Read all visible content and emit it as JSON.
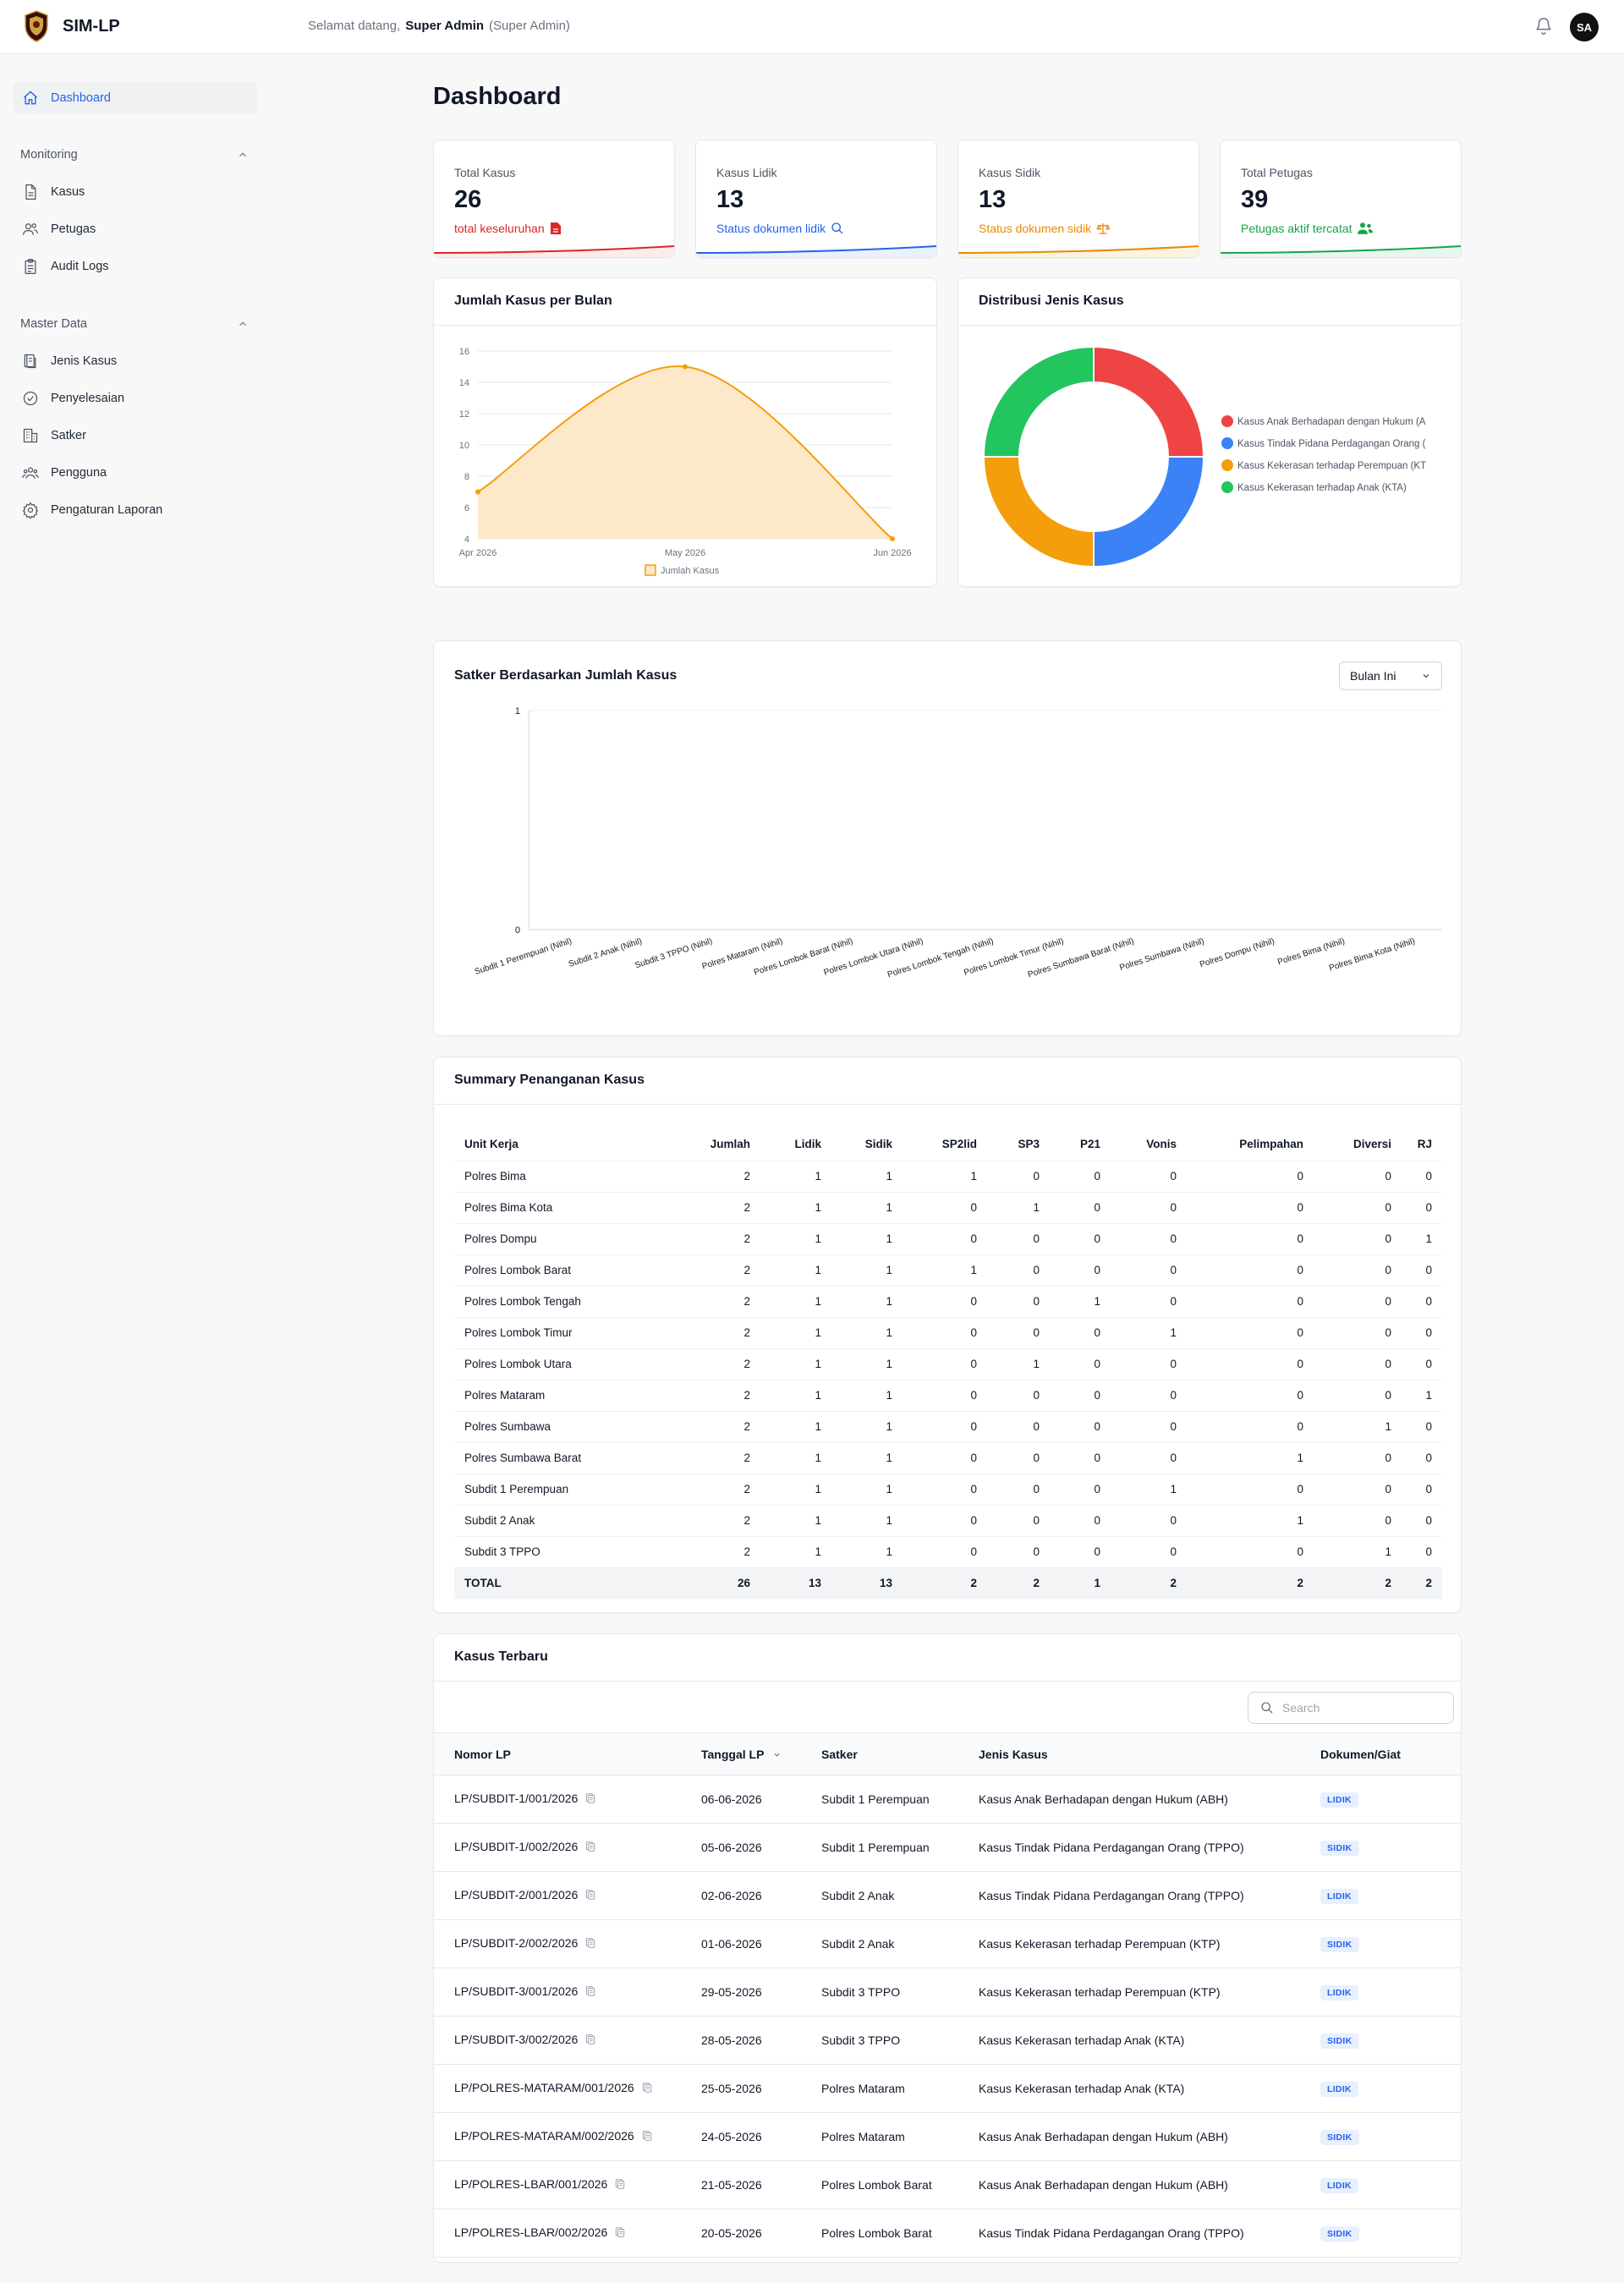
{
  "header": {
    "app_name": "SIM-LP",
    "welcome_prefix": "Selamat datang,",
    "user_name": "Super Admin",
    "user_role": "(Super Admin)",
    "avatar_initials": "SA"
  },
  "sidebar": {
    "dashboard": "Dashboard",
    "group_monitoring": "Monitoring",
    "monitoring_items": [
      "Kasus",
      "Petugas",
      "Audit Logs"
    ],
    "group_master": "Master Data",
    "master_items": [
      "Jenis Kasus",
      "Penyelesaian",
      "Satker",
      "Pengguna",
      "Pengaturan Laporan"
    ]
  },
  "page": {
    "title": "Dashboard"
  },
  "stats": [
    {
      "label": "Total Kasus",
      "value": "26",
      "sub": "total keseluruhan",
      "color": "#dc2626"
    },
    {
      "label": "Kasus Lidik",
      "value": "13",
      "sub": "Status dokumen lidik",
      "color": "#2563eb"
    },
    {
      "label": "Kasus Sidik",
      "value": "13",
      "sub": "Status dokumen sidik",
      "color": "#ea8a00"
    },
    {
      "label": "Total Petugas",
      "value": "39",
      "sub": "Petugas aktif tercatat",
      "color": "#16a34a"
    }
  ],
  "line_chart": {
    "title": "Jumlah Kasus per Bulan",
    "chart_data": {
      "type": "area",
      "categories": [
        "Apr 2026",
        "May 2026",
        "Jun 2026"
      ],
      "series": [
        {
          "name": "Jumlah Kasus",
          "values": [
            7,
            15,
            4
          ]
        }
      ],
      "yticks": [
        4,
        6,
        8,
        10,
        12,
        14,
        16
      ],
      "ylim": [
        4,
        16
      ],
      "color": "#f59e0b",
      "fill": "#fde7c4"
    }
  },
  "donut_chart": {
    "title": "Distribusi Jenis Kasus",
    "chart_data": {
      "type": "pie",
      "labels": [
        "Kasus Anak Berhadapan dengan Hukum (A",
        "Kasus Tindak Pidana Perdagangan Orang (",
        "Kasus Kekerasan terhadap Perempuan (KT",
        "Kasus Kekerasan terhadap Anak (KTA)"
      ],
      "values": [
        25,
        25,
        25,
        25
      ],
      "colors": [
        "#ef4444",
        "#3b82f6",
        "#f59e0b",
        "#22c55e"
      ]
    }
  },
  "bar_chart": {
    "title": "Satker Berdasarkan Jumlah Kasus",
    "filter": "Bulan Ini",
    "chart_data": {
      "type": "bar",
      "categories": [
        "Subdit 1 Perempuan (Nihil)",
        "Subdit 2 Anak (Nihil)",
        "Subdit 3 TPPO (Nihil)",
        "Polres Mataram (Nihil)",
        "Polres Lombok Barat (Nihil)",
        "Polres Lombok Utara (Nihil)",
        "Polres Lombok Tengah (Nihil)",
        "Polres Lombok Timur (Nihil)",
        "Polres Sumbawa Barat (Nihil)",
        "Polres Sumbawa (Nihil)",
        "Polres Dompu (Nihil)",
        "Polres Bima (Nihil)",
        "Polres Bima Kota (Nihil)"
      ],
      "values": [
        0,
        0,
        0,
        0,
        0,
        0,
        0,
        0,
        0,
        0,
        0,
        0,
        0
      ],
      "yticks": [
        0,
        1
      ],
      "ylim": [
        0,
        1
      ]
    }
  },
  "summary": {
    "title": "Summary Penanganan Kasus",
    "headers": [
      "Unit Kerja",
      "Jumlah",
      "Lidik",
      "Sidik",
      "SP2lid",
      "SP3",
      "P21",
      "Vonis",
      "Pelimpahan",
      "Diversi",
      "RJ"
    ],
    "rows": [
      [
        "Polres Bima",
        "2",
        "1",
        "1",
        "1",
        "0",
        "0",
        "0",
        "0",
        "0",
        "0"
      ],
      [
        "Polres Bima Kota",
        "2",
        "1",
        "1",
        "0",
        "1",
        "0",
        "0",
        "0",
        "0",
        "0"
      ],
      [
        "Polres Dompu",
        "2",
        "1",
        "1",
        "0",
        "0",
        "0",
        "0",
        "0",
        "0",
        "1"
      ],
      [
        "Polres Lombok Barat",
        "2",
        "1",
        "1",
        "1",
        "0",
        "0",
        "0",
        "0",
        "0",
        "0"
      ],
      [
        "Polres Lombok Tengah",
        "2",
        "1",
        "1",
        "0",
        "0",
        "1",
        "0",
        "0",
        "0",
        "0"
      ],
      [
        "Polres Lombok Timur",
        "2",
        "1",
        "1",
        "0",
        "0",
        "0",
        "1",
        "0",
        "0",
        "0"
      ],
      [
        "Polres Lombok Utara",
        "2",
        "1",
        "1",
        "0",
        "1",
        "0",
        "0",
        "0",
        "0",
        "0"
      ],
      [
        "Polres Mataram",
        "2",
        "1",
        "1",
        "0",
        "0",
        "0",
        "0",
        "0",
        "0",
        "1"
      ],
      [
        "Polres Sumbawa",
        "2",
        "1",
        "1",
        "0",
        "0",
        "0",
        "0",
        "0",
        "1",
        "0"
      ],
      [
        "Polres Sumbawa Barat",
        "2",
        "1",
        "1",
        "0",
        "0",
        "0",
        "0",
        "1",
        "0",
        "0"
      ],
      [
        "Subdit 1 Perempuan",
        "2",
        "1",
        "1",
        "0",
        "0",
        "0",
        "1",
        "0",
        "0",
        "0"
      ],
      [
        "Subdit 2 Anak",
        "2",
        "1",
        "1",
        "0",
        "0",
        "0",
        "0",
        "1",
        "0",
        "0"
      ],
      [
        "Subdit 3 TPPO",
        "2",
        "1",
        "1",
        "0",
        "0",
        "0",
        "0",
        "0",
        "1",
        "0"
      ]
    ],
    "total": [
      "TOTAL",
      "26",
      "13",
      "13",
      "2",
      "2",
      "1",
      "2",
      "2",
      "2",
      "2"
    ]
  },
  "recent": {
    "title": "Kasus Terbaru",
    "search_placeholder": "Search",
    "headers": [
      "Nomor LP",
      "Tanggal LP",
      "Satker",
      "Jenis Kasus",
      "Dokumen/Giat"
    ],
    "rows": [
      [
        "LP/SUBDIT-1/001/2026",
        "06-06-2026",
        "Subdit 1 Perempuan",
        "Kasus Anak Berhadapan dengan Hukum (ABH)",
        "LIDIK"
      ],
      [
        "LP/SUBDIT-1/002/2026",
        "05-06-2026",
        "Subdit 1 Perempuan",
        "Kasus Tindak Pidana Perdagangan Orang (TPPO)",
        "SIDIK"
      ],
      [
        "LP/SUBDIT-2/001/2026",
        "02-06-2026",
        "Subdit 2 Anak",
        "Kasus Tindak Pidana Perdagangan Orang (TPPO)",
        "LIDIK"
      ],
      [
        "LP/SUBDIT-2/002/2026",
        "01-06-2026",
        "Subdit 2 Anak",
        "Kasus Kekerasan terhadap Perempuan (KTP)",
        "SIDIK"
      ],
      [
        "LP/SUBDIT-3/001/2026",
        "29-05-2026",
        "Subdit 3 TPPO",
        "Kasus Kekerasan terhadap Perempuan (KTP)",
        "LIDIK"
      ],
      [
        "LP/SUBDIT-3/002/2026",
        "28-05-2026",
        "Subdit 3 TPPO",
        "Kasus Kekerasan terhadap Anak (KTA)",
        "SIDIK"
      ],
      [
        "LP/POLRES-MATARAM/001/2026",
        "25-05-2026",
        "Polres Mataram",
        "Kasus Kekerasan terhadap Anak (KTA)",
        "LIDIK"
      ],
      [
        "LP/POLRES-MATARAM/002/2026",
        "24-05-2026",
        "Polres Mataram",
        "Kasus Anak Berhadapan dengan Hukum (ABH)",
        "SIDIK"
      ],
      [
        "LP/POLRES-LBAR/001/2026",
        "21-05-2026",
        "Polres Lombok Barat",
        "Kasus Anak Berhadapan dengan Hukum (ABH)",
        "LIDIK"
      ],
      [
        "LP/POLRES-LBAR/002/2026",
        "20-05-2026",
        "Polres Lombok Barat",
        "Kasus Tindak Pidana Perdagangan Orang (TPPO)",
        "SIDIK"
      ]
    ]
  }
}
